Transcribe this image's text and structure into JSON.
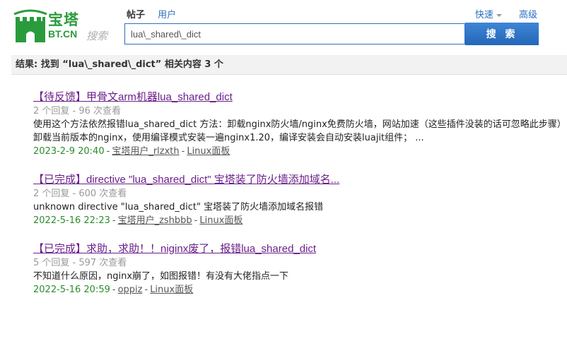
{
  "header": {
    "logo_cn": "宝塔",
    "logo_en": "BT.CN",
    "logo_search_word": "搜索",
    "tabs": [
      {
        "label": "帖子",
        "active": true
      },
      {
        "label": "用户",
        "active": false
      }
    ],
    "quick_label": "快速",
    "advanced_label": "高级",
    "search_value": "lua\\_shared\\_dict",
    "search_button": "搜 索"
  },
  "result_bar": {
    "text": "结果: 找到 “lua\\_shared\\_dict” 相关内容 3 个"
  },
  "results": [
    {
      "title": "【待反馈】甲骨文arm机器lua_shared_dict",
      "stats": "2 个回复 - 96 次查看",
      "excerpt": "使用这个方法依然报错lua_shared_dict 方法：卸载nginx防火墙/nginx免费防火墙，网站加速（这些插件没装的话可忽略此步骤）卸载当前版本的nginx，使用编译模式安装一遍nginx1.20，编译安装会自动安装luajit组件； ...",
      "date": "2023-2-9 20:40",
      "author": "宝塔用户_rlzxth",
      "forum": "Linux面板"
    },
    {
      "title": "【已完成】directive \"lua_shared_dict\" 宝塔装了防火墙添加域名...",
      "stats": "2 个回复 - 600 次查看",
      "excerpt": "unknown directive \"lua_shared_dict\" 宝塔装了防火墙添加域名报错",
      "date": "2022-5-16 22:23",
      "author": "宝塔用户_zshbbb",
      "forum": "Linux面板"
    },
    {
      "title": "【已完成】求助，求助！！niginx废了，报错lua_shared_dict",
      "stats": "5 个回复 - 597 次查看",
      "excerpt": "不知道什么原因，nginx崩了，如图报错！有没有大佬指点一下",
      "date": "2022-5-16 20:59",
      "author": "oppiz",
      "forum": "Linux面板"
    }
  ],
  "colors": {
    "brand_green": "#2a9b3c",
    "link_blue": "#2b6ec1",
    "title_purple": "#6b1f8a",
    "date_green": "#2a8d2a"
  }
}
